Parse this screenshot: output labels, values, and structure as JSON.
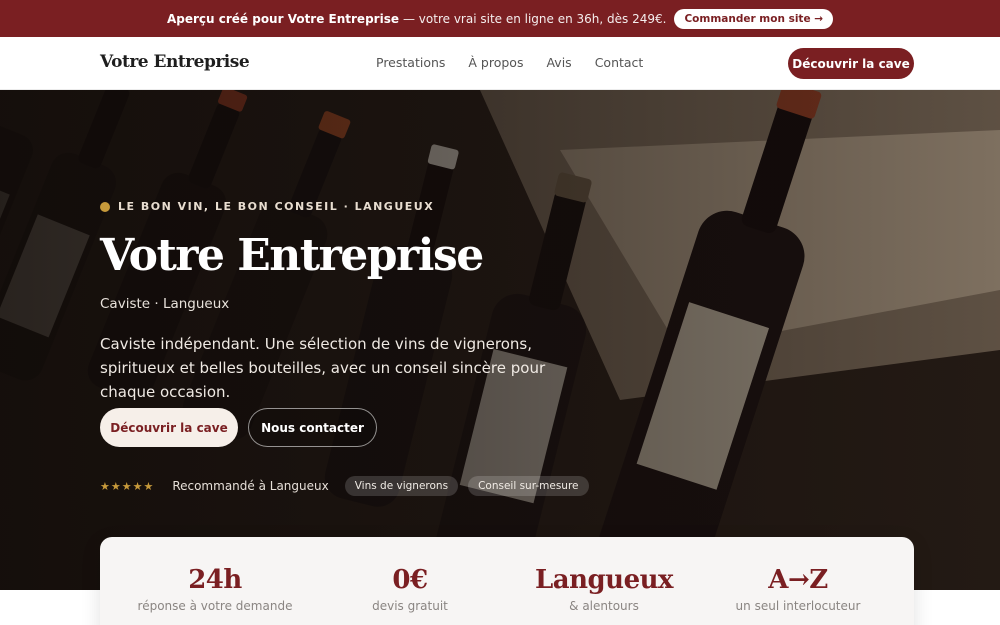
{
  "announcement": {
    "strong": "Aperçu créé pour Votre Entreprise",
    "rest": "— votre vrai site en ligne en 36h, dès 249€.",
    "cta": "Commander mon site →"
  },
  "header": {
    "brand": "Votre Entreprise",
    "nav": [
      "Prestations",
      "À propos",
      "Avis",
      "Contact"
    ],
    "cta": "Découvrir la cave"
  },
  "hero": {
    "eyebrow": "LE BON VIN, LE BON CONSEIL · LANGUEUX",
    "title": "Votre Entreprise",
    "subtitle": "Caviste · Langueux",
    "description": "Caviste indépendant. Une sélection de vins de vignerons, spiritueux et belles bouteilles, avec un conseil sincère pour chaque occasion.",
    "primary_button": "Découvrir la cave",
    "secondary_button": "Nous contacter",
    "stars": "★★★★★",
    "recommendation": "Recommandé à Langueux",
    "tags": [
      "Vins de vignerons",
      "Conseil sur-mesure"
    ]
  },
  "stats": [
    {
      "value": "24h",
      "label": "réponse à votre demande"
    },
    {
      "value": "0€",
      "label": "devis gratuit"
    },
    {
      "value": "Langueux",
      "label": "& alentours"
    },
    {
      "value": "A→Z",
      "label": "un seul interlocuteur"
    }
  ],
  "colors": {
    "accent": "#7a1f22",
    "gold": "#c79a3b"
  }
}
